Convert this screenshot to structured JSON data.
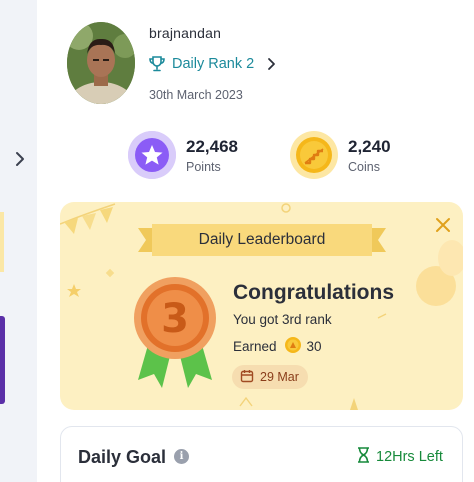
{
  "profile": {
    "username": "brajnandan",
    "rank_label": "Daily Rank 2",
    "date": "30th March 2023",
    "avatar_icon": "user-photo"
  },
  "stats": {
    "points": {
      "value": "22,468",
      "label": "Points",
      "icon": "star-icon",
      "color": "#8b5cf6"
    },
    "coins": {
      "value": "2,240",
      "label": "Coins",
      "icon": "coin-stairs-icon",
      "color": "#f5b71a"
    }
  },
  "leaderboard": {
    "title": "Daily Leaderboard",
    "medal_rank": "3",
    "heading": "Congratulations",
    "message": "You got 3rd rank",
    "earned_label": "Earned",
    "earned_coins": "30",
    "date_chip": "29 Mar",
    "accent": "#f59e0b"
  },
  "daily_goal": {
    "title": "Daily Goal",
    "info_icon": "i",
    "time_left": "12Hrs Left",
    "accent": "#178a3b"
  }
}
